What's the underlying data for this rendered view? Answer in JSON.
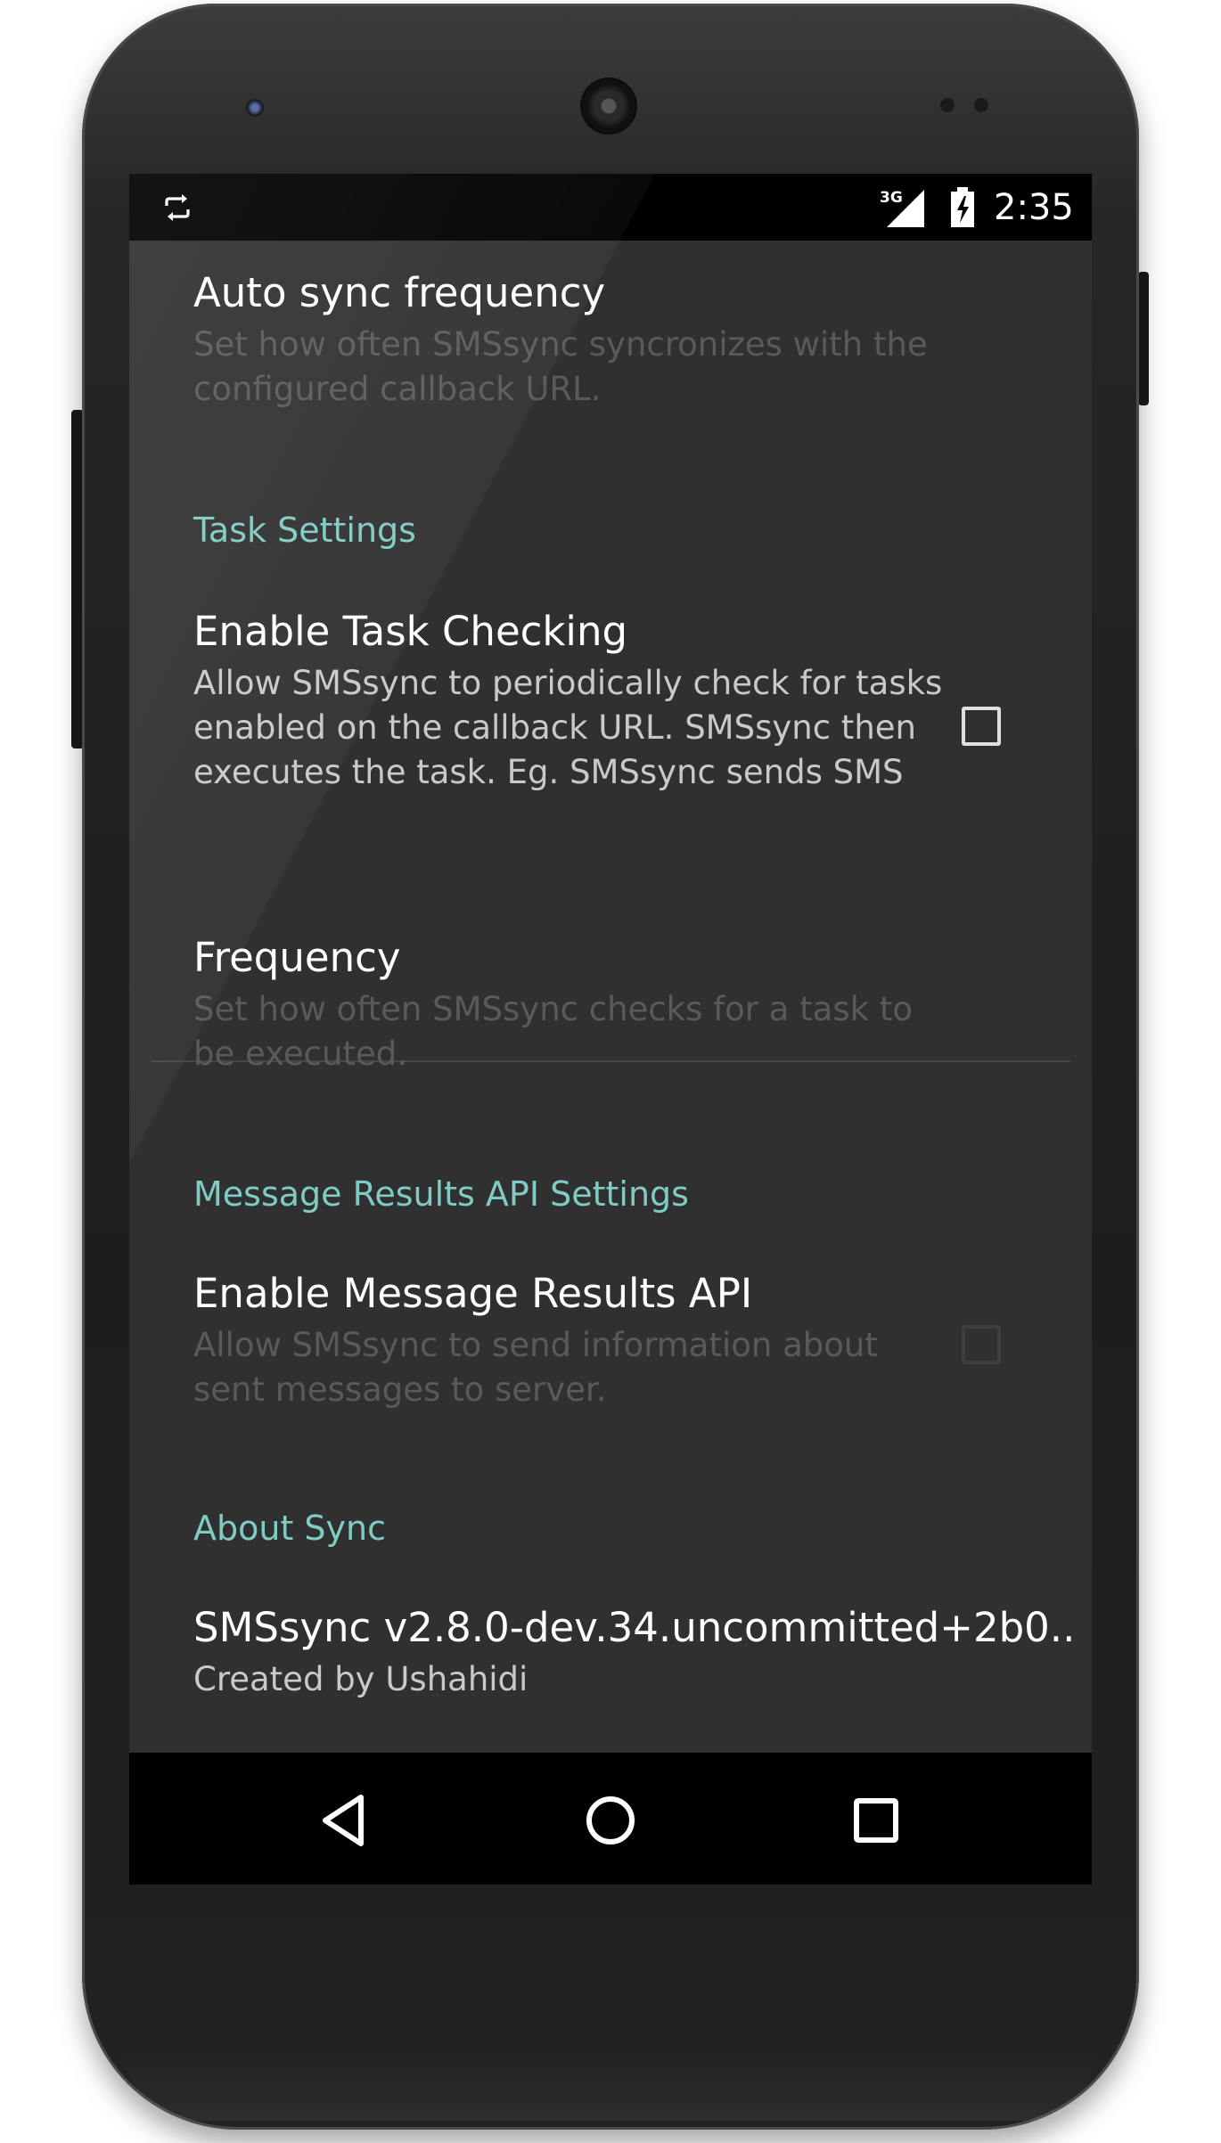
{
  "status_bar": {
    "time": "2:35",
    "network": "3G",
    "icons": [
      "sync-icon",
      "signal-icon",
      "battery-charging-icon"
    ]
  },
  "settings": {
    "auto_sync_frequency": {
      "title": "Auto sync frequency",
      "summary": "Set how often SMSsync syncronizes with the configured callback URL.",
      "enabled": false
    },
    "task_settings_category": "Task Settings",
    "enable_task_checking": {
      "title": "Enable Task Checking",
      "summary": "Allow SMSsync to periodically check for tasks enabled on the callback URL. SMSsync then executes the task. Eg. SMSsync sends SMS",
      "checked": false
    },
    "frequency": {
      "title": "Frequency",
      "summary": "Set how often SMSsync checks for a task to be executed.",
      "enabled": false
    },
    "message_results_category": "Message Results API Settings",
    "enable_message_results": {
      "title": "Enable Message Results API",
      "summary": "Allow SMSsync to send information about sent messages to server.",
      "checked": false,
      "enabled": false
    },
    "about_category": "About Sync",
    "about": {
      "title": "SMSsync v2.8.0-dev.34.uncommitted+2b0..",
      "summary": "Created by Ushahidi"
    }
  },
  "navigation_bar": {
    "icons": [
      "back-icon",
      "home-icon",
      "recents-icon"
    ]
  },
  "colors": {
    "accent": "#80cbc4",
    "background": "#303030",
    "bars": "#000000"
  }
}
